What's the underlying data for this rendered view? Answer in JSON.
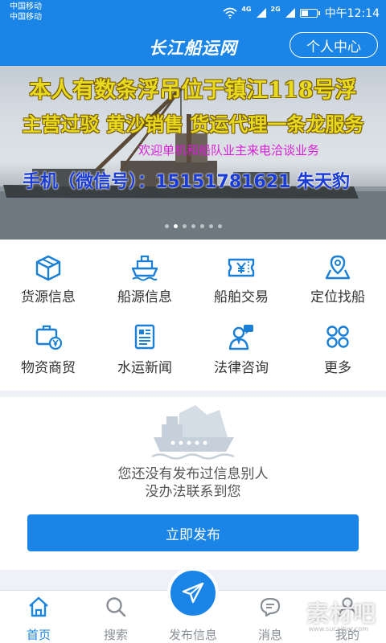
{
  "status_bar": {
    "carrier_1": "中国移动",
    "carrier_2": "中国移动",
    "net_1": "4G",
    "net_2": "2G",
    "time": "中午12:14",
    "battery_level": 0.4
  },
  "header": {
    "title": "长江船运网",
    "profile_button": "个人中心"
  },
  "banner": {
    "line1": "本人有数条浮吊位于镇江118号浮",
    "line2": "主营过驳 黄沙销售 货运代理一条龙服务",
    "line3": "欢迎单机和船队业主来电洽谈业务",
    "line4": "手机（微信号）：15151781621   朱天豹",
    "page_count": 7,
    "active_page": 1
  },
  "grid": {
    "items": [
      {
        "label": "货源信息",
        "icon": "cargo-box-icon"
      },
      {
        "label": "船源信息",
        "icon": "ship-icon"
      },
      {
        "label": "船舶交易",
        "icon": "ticket-yen-icon"
      },
      {
        "label": "定位找船",
        "icon": "location-map-icon"
      },
      {
        "label": "物资商贸",
        "icon": "briefcase-yen-icon"
      },
      {
        "label": "水运新闻",
        "icon": "newspaper-icon"
      },
      {
        "label": "法律咨询",
        "icon": "consultant-icon"
      },
      {
        "label": "更多",
        "icon": "grid-more-icon"
      }
    ]
  },
  "empty_state": {
    "line1": "您还没有发布过信息别人",
    "line2": "没办法联系到您",
    "publish_button": "立即发布"
  },
  "tab_bar": {
    "tabs": [
      {
        "label": "首页",
        "icon": "home-icon"
      },
      {
        "label": "搜索",
        "icon": "search-icon"
      },
      {
        "label": "发布信息",
        "icon": "paper-plane-icon"
      },
      {
        "label": "消息",
        "icon": "message-icon"
      },
      {
        "label": "我的",
        "icon": "user-icon"
      }
    ],
    "active": 0
  },
  "watermark": {
    "text": "素材吧",
    "sub": "www.sucaibar.com"
  },
  "colors": {
    "primary": "#1a85e6",
    "icon_blue": "#1a7fd6",
    "banner_yellow": "#e8da1e",
    "banner_magenta": "#d81fd8",
    "banner_blue": "#1a3bd6"
  }
}
